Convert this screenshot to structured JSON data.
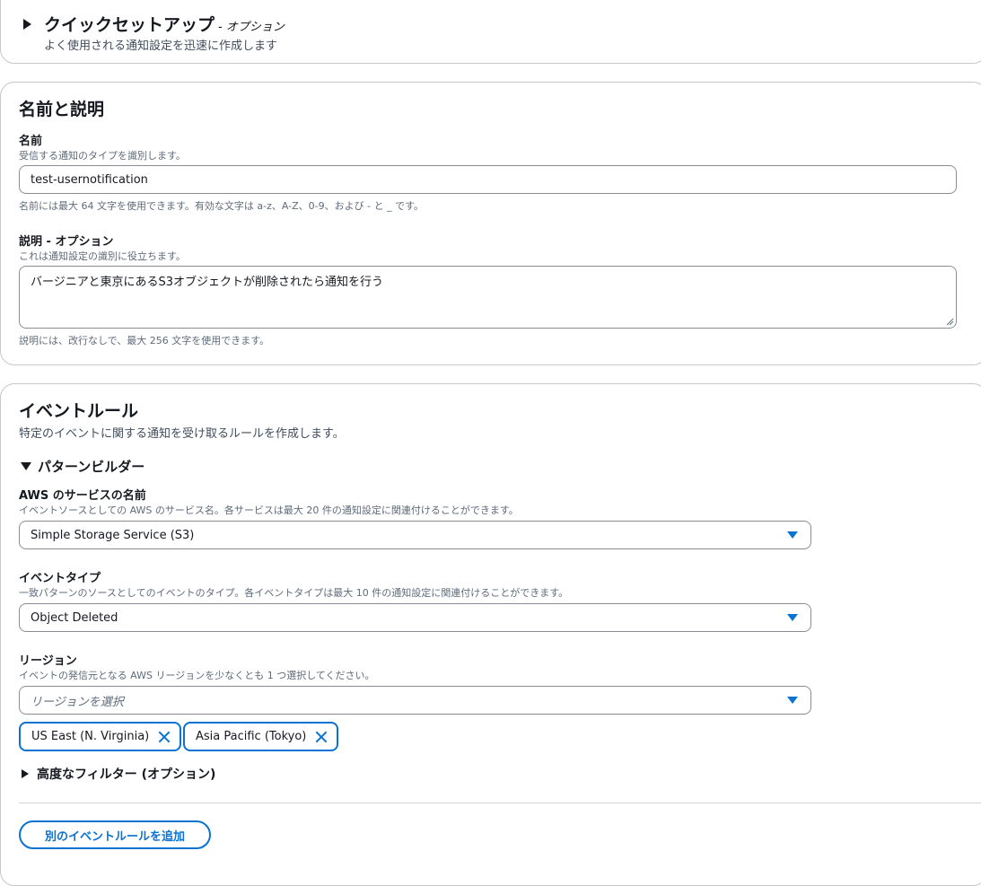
{
  "quick_setup": {
    "title": "クイックセットアップ",
    "optional": "- オプション",
    "description": "よく使用される通知設定を迅速に作成します"
  },
  "name_section": {
    "title": "名前と説明",
    "name": {
      "label": "名前",
      "description": "受信する通知のタイプを識別します。",
      "value": "test-usernotification",
      "constraint": "名前には最大 64 文字を使用できます。有効な文字は a-z、A-Z、0-9、および - と _ です。"
    },
    "description_field": {
      "label": "説明 - オプション",
      "description": "これは通知設定の識別に役立ちます。",
      "value": "バージニアと東京にあるS3オブジェクトが削除されたら通知を行う",
      "constraint": "説明には、改行なしで、最大 256 文字を使用できます。"
    }
  },
  "event_rule": {
    "title": "イベントルール",
    "description": "特定のイベントに関する通知を受け取るルールを作成します。",
    "pattern_builder": "パターンビルダー",
    "service": {
      "label": "AWS のサービスの名前",
      "description": "イベントソースとしての AWS のサービス名。各サービスは最大 20 件の通知設定に関連付けることができます。",
      "value": "Simple Storage Service (S3)"
    },
    "event_type": {
      "label": "イベントタイプ",
      "description": "一致パターンのソースとしてのイベントのタイプ。各イベントタイプは最大 10 件の通知設定に関連付けることができます。",
      "value": "Object Deleted"
    },
    "region": {
      "label": "リージョン",
      "description": "イベントの発信元となる AWS リージョンを少なくとも 1 つ選択してください。",
      "placeholder": "リージョンを選択",
      "tokens": [
        "US East (N. Virginia)",
        "Asia Pacific (Tokyo)"
      ]
    },
    "advanced_filter": "高度なフィルター (オプション)",
    "add_button": "別のイベントルールを追加"
  },
  "colors": {
    "accent": "#0972d3",
    "border": "#8c8c94",
    "text": "#16191f"
  }
}
